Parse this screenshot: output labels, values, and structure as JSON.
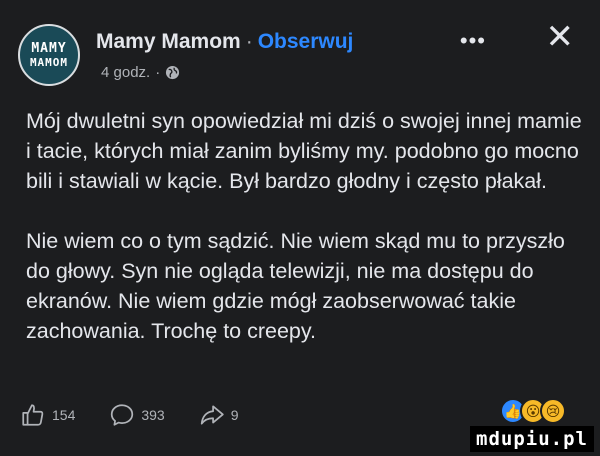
{
  "post": {
    "avatar": {
      "line1": "MAMY",
      "line2": "MAMOM"
    },
    "author": "Mamy Mamom",
    "separator": "·",
    "follow_label": "Obserwuj",
    "time": "4 godz.",
    "time_separator": "·",
    "more_label": "•••",
    "close_label": "✕",
    "paragraphs": [
      "Mój dwuletni syn opowiedział mi dziś o swojej innej mamie i tacie, których miał zanim byliśmy my. podobno go mocno bili i stawiali w kącie. Był bardzo głodny i często płakał.",
      "Nie wiem co o tym sądzić. Nie wiem skąd mu to przyszło do głowy. Syn nie ogląda telewizji, nie ma dostępu do ekranów. Nie wiem gdzie mógł zaobserwować takie zachowania. Trochę to creepy."
    ]
  },
  "actions": {
    "likes": "154",
    "comments": "393",
    "shares": "9"
  },
  "reactions": [
    {
      "icon": "thumbs-up-icon",
      "glyph": "👍"
    },
    {
      "icon": "wow-face-icon",
      "glyph": "😮"
    },
    {
      "icon": "sad-face-icon",
      "glyph": "😢"
    }
  ],
  "watermark": "mdupiu.pl",
  "colors": {
    "background": "#1c1d1f",
    "text": "#e4e6eb",
    "muted": "#b0b3b8",
    "accent": "#2d88ff"
  }
}
